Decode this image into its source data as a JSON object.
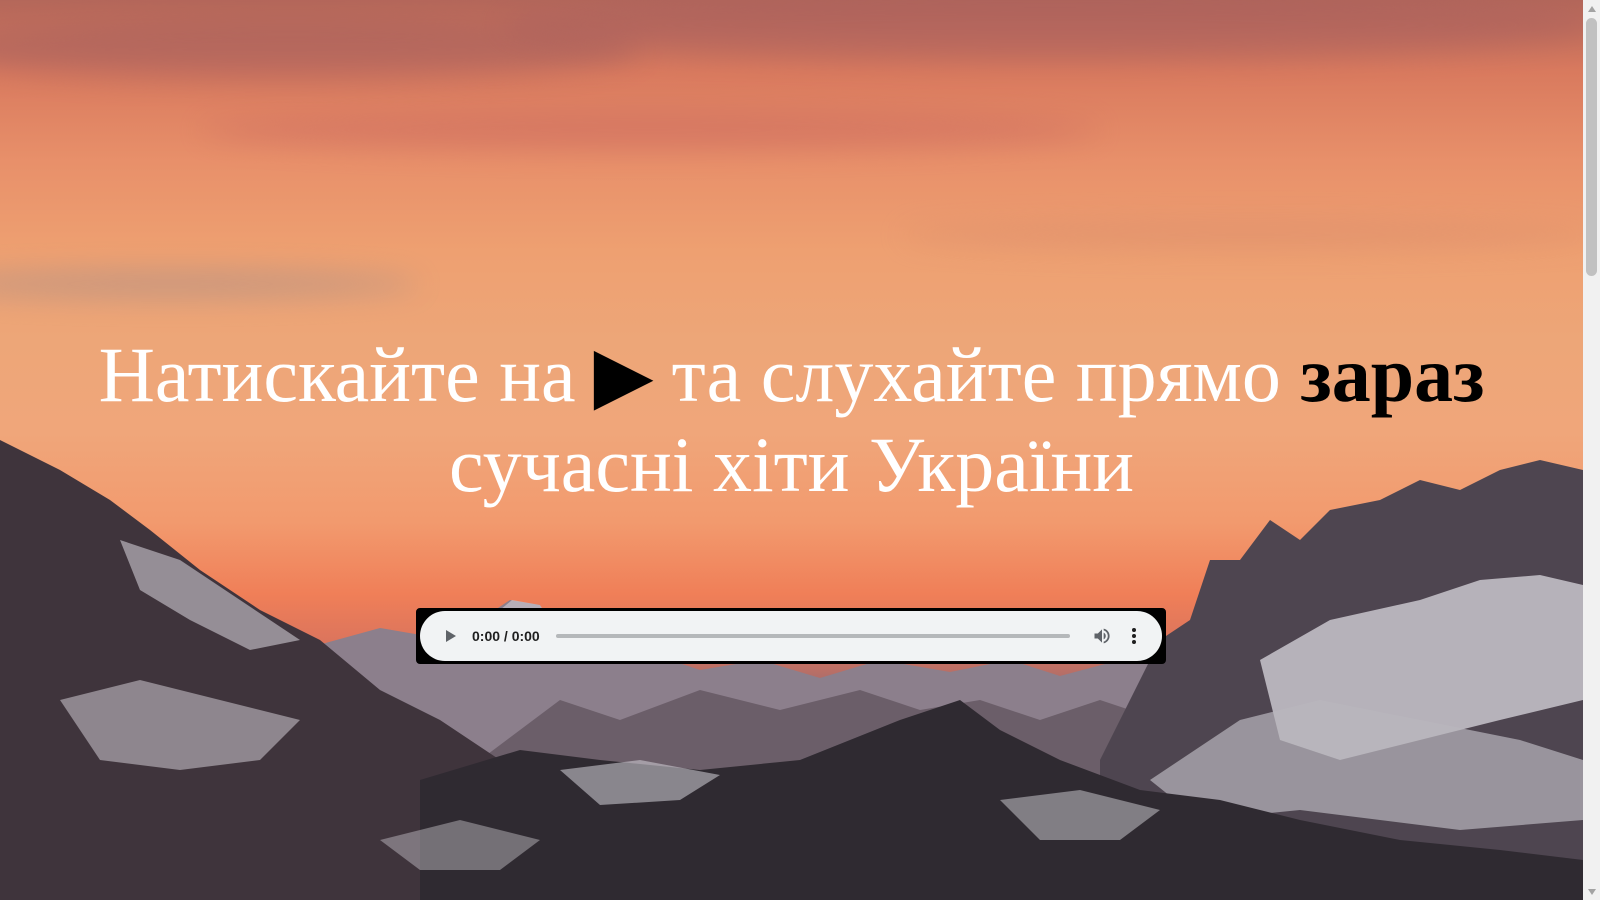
{
  "hero": {
    "part1": "Натискайте на",
    "play_glyph": "▶",
    "part2": "та слухайте прямо",
    "emphasis": "зараз",
    "line2": "сучасні хіти України"
  },
  "player": {
    "time_display": "0:00 / 0:00",
    "progress": 0,
    "icons": {
      "play": "play-icon",
      "volume": "volume-icon",
      "more": "more-options-icon"
    }
  },
  "colors": {
    "hero_text": "#ffffff",
    "emphasis_text": "#000000",
    "player_bg": "#f1f3f4"
  }
}
